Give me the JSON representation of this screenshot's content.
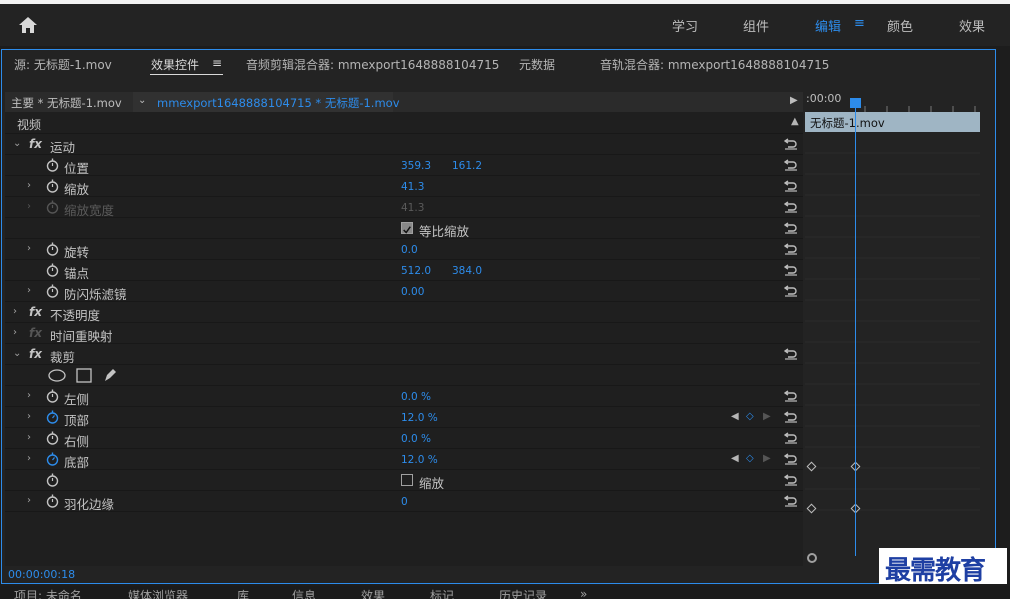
{
  "header": {
    "workspaces": [
      "学习",
      "组件",
      "编辑",
      "颜色",
      "效果"
    ],
    "active_workspace": "编辑",
    "menu_glyph": "≡"
  },
  "panel": {
    "tabs": {
      "source": "源: 无标题-1.mov",
      "effect_controls": "效果控件",
      "effect_controls_menu": "≡",
      "audio_clip_mixer": "音频剪辑混合器: mmexport1648888104715",
      "metadata": "元数据",
      "audio_track_mixer": "音轨混合器: mmexport1648888104715"
    },
    "clip_bar": {
      "master": "主要 * 无标题-1.mov",
      "selected": "mmexport1648888104715 * 无标题-1.mov"
    },
    "video_section": "视频",
    "rows": {
      "motion": "运动",
      "position": "位置",
      "position_x": "359.3",
      "position_y": "161.2",
      "scale": "缩放",
      "scale_value": "41.3",
      "scale_width": "缩放宽度",
      "scale_width_value": "41.3",
      "uniform_scale": "等比缩放",
      "rotation": "旋转",
      "rotation_value": "0.0",
      "anchor": "锚点",
      "anchor_x": "512.0",
      "anchor_y": "384.0",
      "anti_flicker": "防闪烁滤镜",
      "anti_flicker_value": "0.00",
      "opacity": "不透明度",
      "time_remap": "时间重映射",
      "crop": "裁剪",
      "left": "左侧",
      "left_value": "0.0 %",
      "top": "顶部",
      "top_value": "12.0 %",
      "right": "右侧",
      "right_value": "0.0 %",
      "bottom": "底部",
      "bottom_value": "12.0 %",
      "zoom": "缩放",
      "feather": "羽化边缘",
      "feather_value": "0"
    },
    "timeline": {
      "time": ":00:00",
      "clip_name": "无标题-1.mov"
    },
    "timecode": "00:00:00:18"
  },
  "bottom_tabs": [
    "项目: 未命名",
    "媒体浏览器",
    "库",
    "信息",
    "效果",
    "标记",
    "历史记录",
    "»"
  ],
  "watermark": "最需教育",
  "colors": {
    "accent": "#2d8ceb",
    "clip": "#9fb5c4"
  }
}
